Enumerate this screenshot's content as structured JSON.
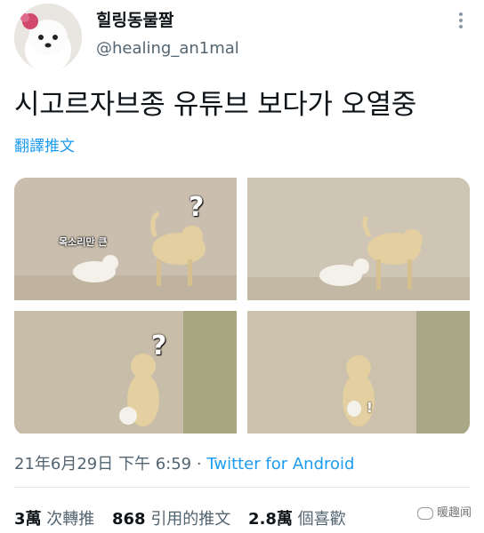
{
  "user": {
    "display_name": "힐링동물짤",
    "handle": "@healing_an1mal"
  },
  "tweet": {
    "text": "시고르자브종 유튜브 보다가 오열중",
    "translate_label": "翻譯推文"
  },
  "media": {
    "panel1_caption": "목소리만 큰",
    "panel1_mark": "?",
    "panel3_mark": "?",
    "panel4_mark": "!"
  },
  "meta": {
    "timestamp": "21年6月29日 下午 6:59",
    "separator": "·",
    "source": "Twitter for Android"
  },
  "stats": {
    "retweets_count": "3萬",
    "retweets_label": "次轉推",
    "quotes_count": "868",
    "quotes_label": "引用的推文",
    "likes_count": "2.8萬",
    "likes_label": "個喜歡"
  },
  "watermark": {
    "text": "暖趣闻"
  },
  "colors": {
    "link": "#1d9bf0",
    "secondary_text": "#536471",
    "primary_text": "#0f1419",
    "photo_ground": "#c9bfae"
  }
}
